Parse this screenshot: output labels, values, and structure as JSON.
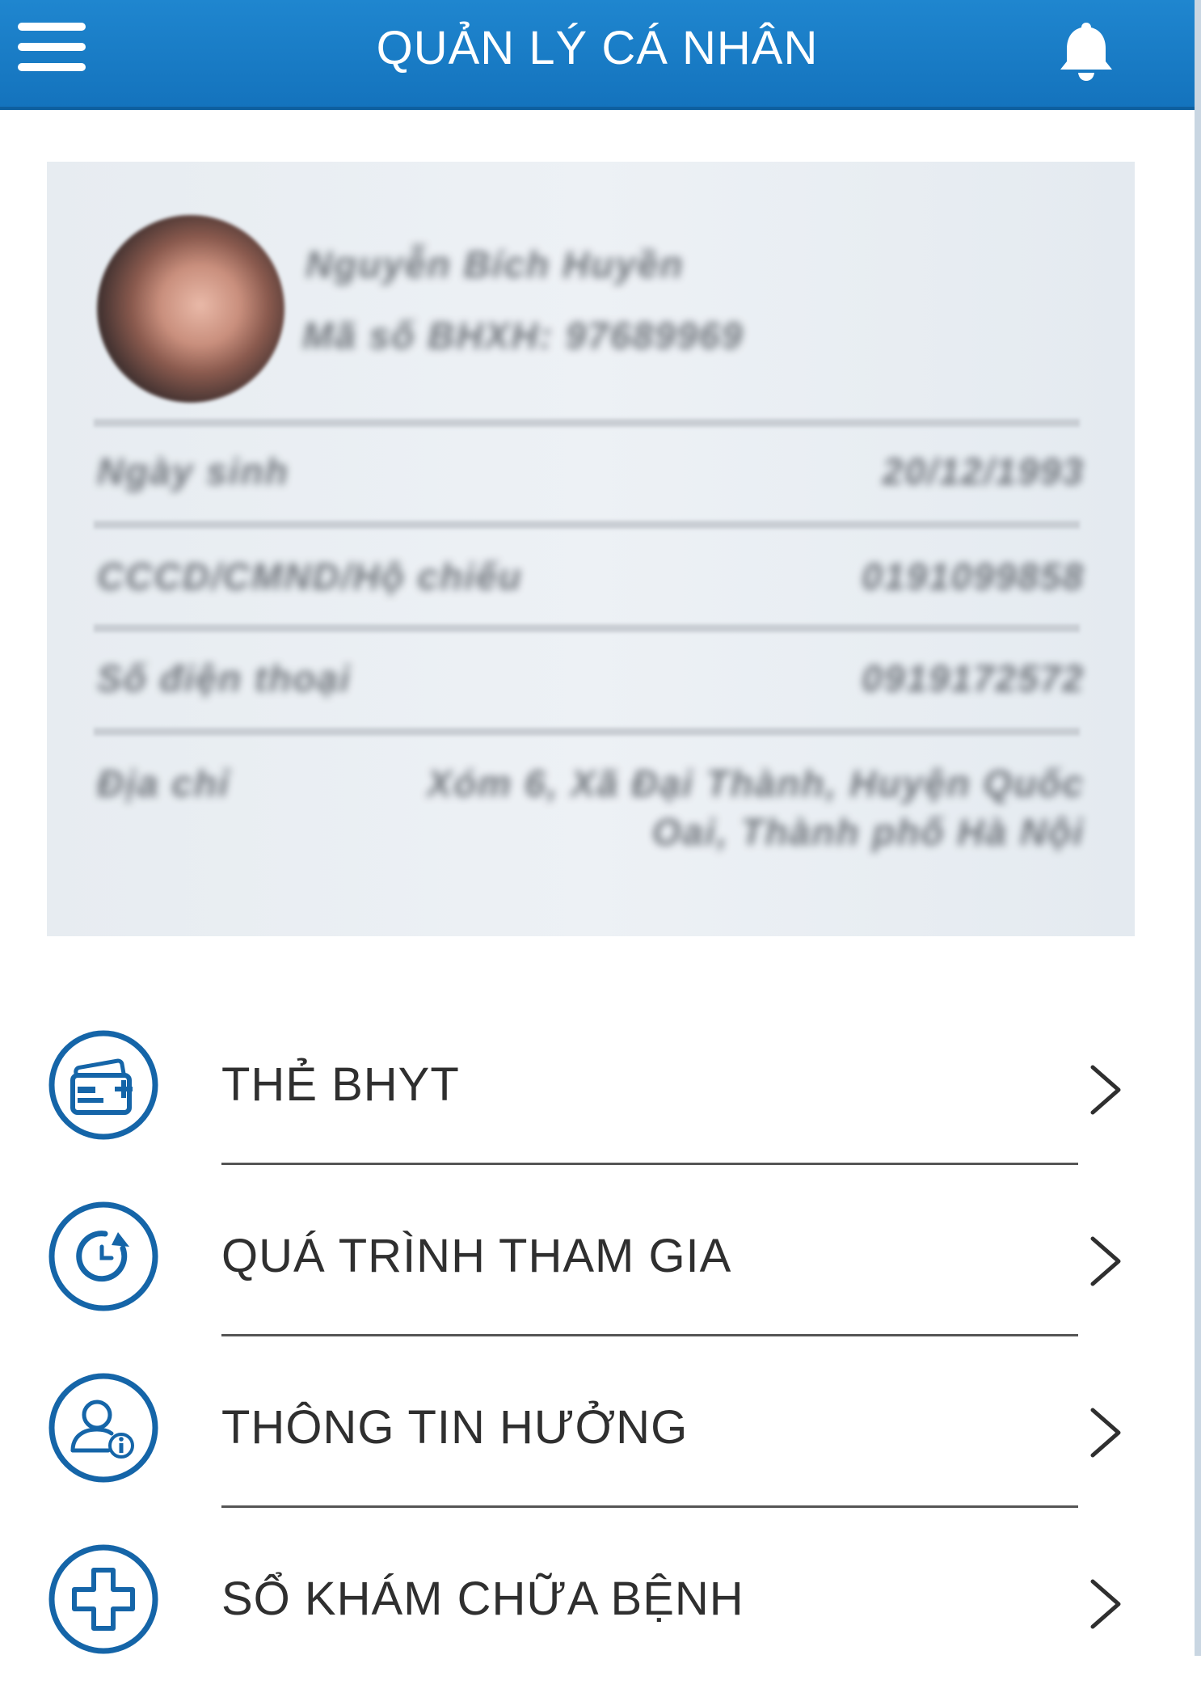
{
  "header": {
    "title": "QUẢN LÝ CÁ NHÂN",
    "menu_icon": "hamburger-icon",
    "notification_icon": "bell-icon"
  },
  "profile": {
    "name": "Nguyễn Bích Huyền",
    "code": "Mã số BHXH: 97689969",
    "rows": [
      {
        "label": "Ngày sinh",
        "value": "20/12/1993"
      },
      {
        "label": "CCCD/CMND/Hộ chiếu",
        "value": "0191099858"
      },
      {
        "label": "Số điện thoại",
        "value": "0919172572"
      },
      {
        "label": "Địa chỉ",
        "value": "Xóm 6, Xã Đại Thành, Huyện Quốc",
        "value2": "Oai, Thành phố Hà Nội"
      }
    ]
  },
  "menu": [
    {
      "label": "THẺ BHYT",
      "icon": "health-card-icon"
    },
    {
      "label": "QUÁ TRÌNH THAM GIA",
      "icon": "history-icon"
    },
    {
      "label": "THÔNG TIN HƯỞNG",
      "icon": "user-info-icon"
    },
    {
      "label": "SỔ KHÁM CHỮA BỆNH",
      "icon": "medical-cross-icon"
    }
  ],
  "colors": {
    "header": "#1a7ec8",
    "icon_blue": "#1565a8",
    "text": "#2f2f2f"
  }
}
